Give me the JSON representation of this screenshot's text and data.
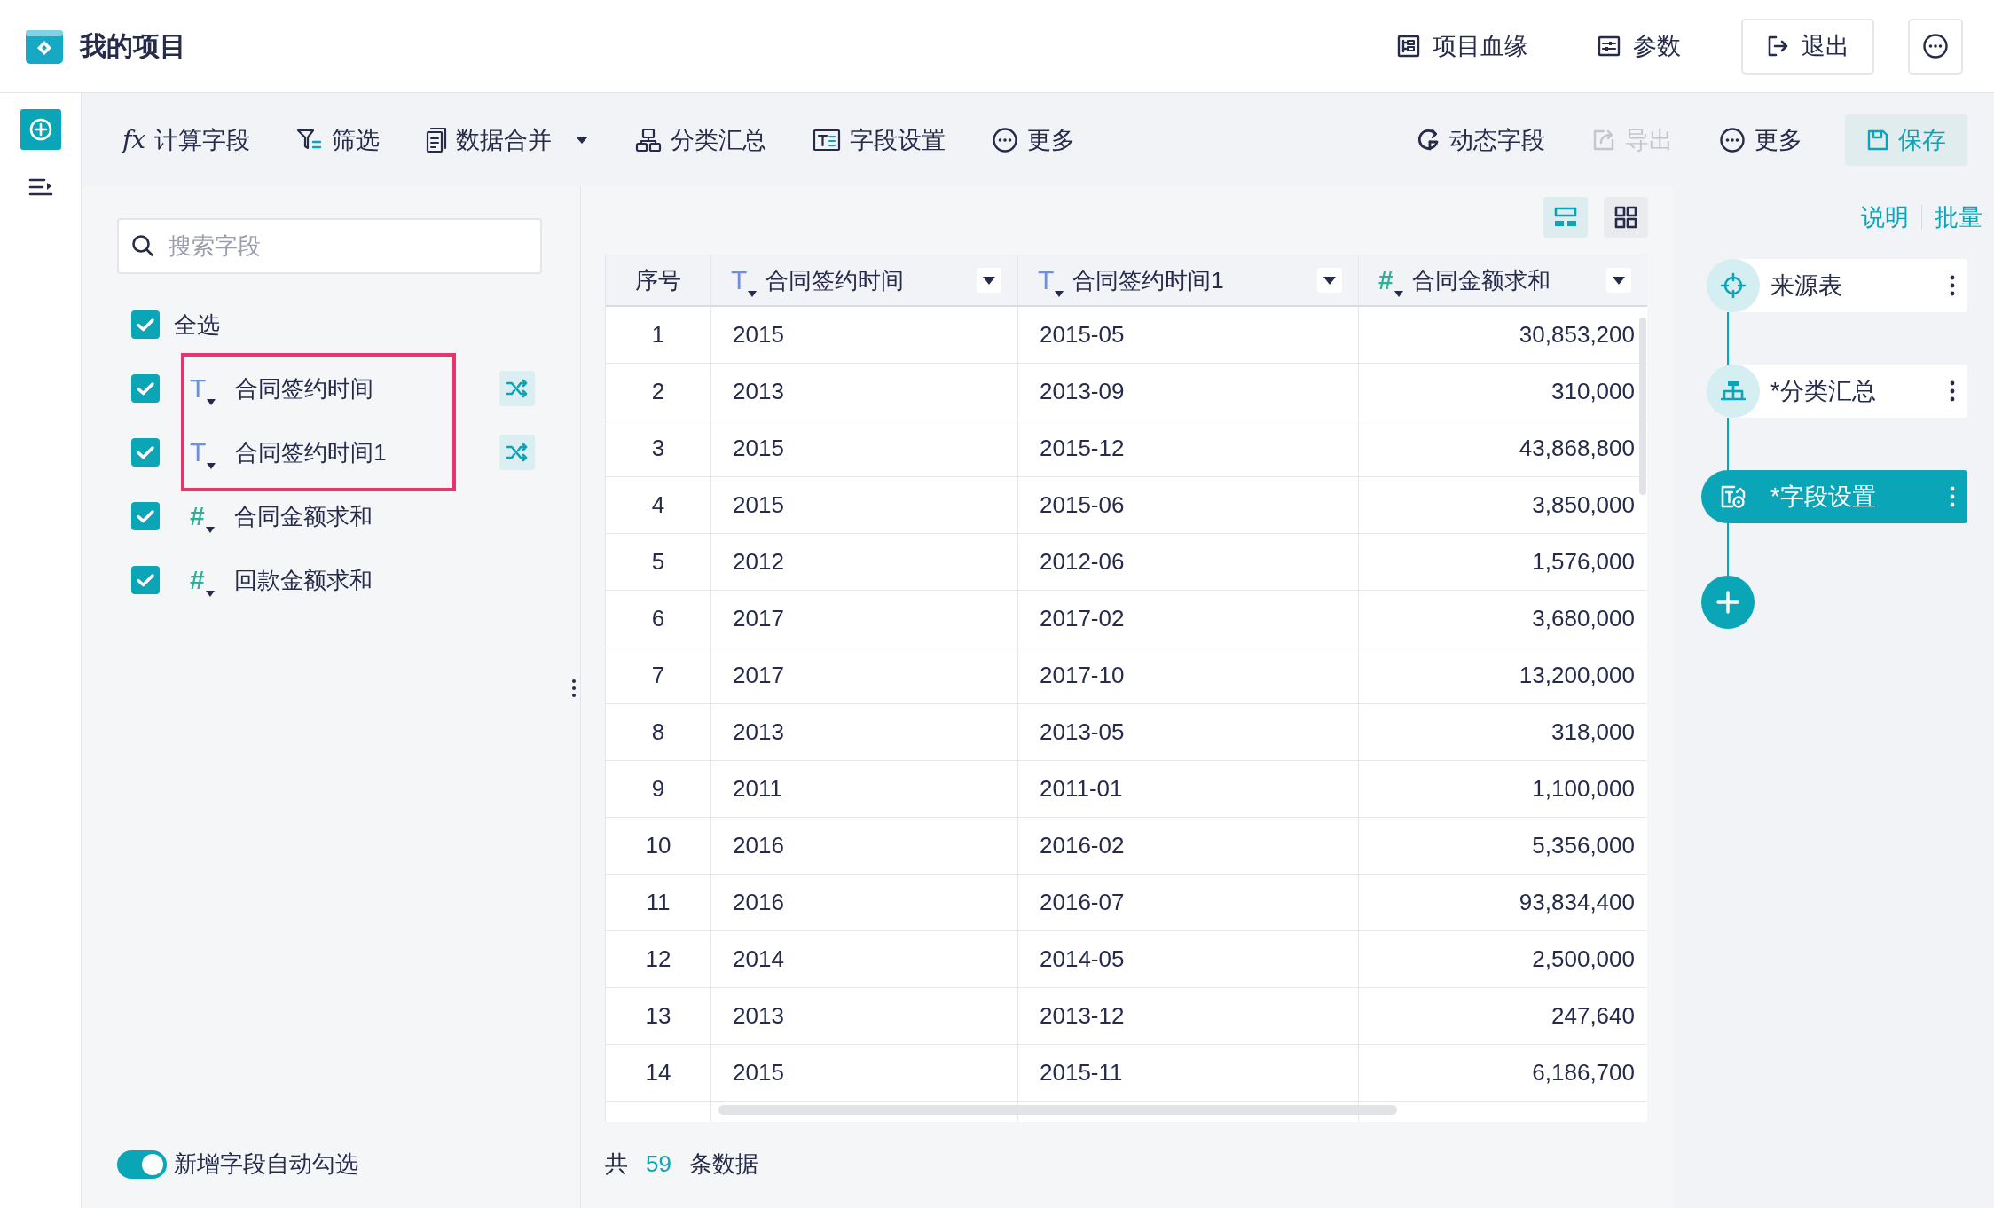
{
  "app": {
    "title": "我的项目"
  },
  "header_actions": [
    {
      "kind": "lineage",
      "label": "项目血缘"
    },
    {
      "kind": "params",
      "label": "参数"
    },
    {
      "kind": "exit",
      "label": "退出"
    },
    {
      "kind": "more"
    }
  ],
  "rail": [
    {
      "kind": "add"
    },
    {
      "kind": "list"
    }
  ],
  "toolbar": {
    "left": [
      {
        "kind": "formula",
        "symbol": "fx",
        "label": "计算字段"
      },
      {
        "kind": "filter",
        "label": "筛选"
      },
      {
        "kind": "merge",
        "label": "数据合并",
        "dropdown": true
      },
      {
        "kind": "group",
        "label": "分类汇总"
      },
      {
        "kind": "fields",
        "label": "字段设置"
      },
      {
        "kind": "more",
        "label": "更多"
      }
    ],
    "right": [
      {
        "kind": "dynamic",
        "label": "动态字段",
        "disabled": false
      },
      {
        "kind": "export",
        "label": "导出",
        "disabled": true
      },
      {
        "kind": "more",
        "label": "更多",
        "disabled": false
      },
      {
        "kind": "save",
        "label": "保存",
        "disabled": false
      }
    ]
  },
  "field_panel": {
    "search": {
      "placeholder": "搜索字段"
    },
    "select_all": {
      "label": "全选",
      "checked": true
    },
    "fields": [
      {
        "kind": "text",
        "symbol": "T",
        "label": "合同签约时间",
        "checked": true,
        "highlighted": true,
        "shuffle": true
      },
      {
        "kind": "text",
        "symbol": "T",
        "label": "合同签约时间1",
        "checked": true,
        "highlighted": true,
        "shuffle": true
      },
      {
        "kind": "number",
        "symbol": "#",
        "label": "合同金额求和",
        "checked": true,
        "highlighted": false,
        "shuffle": false
      },
      {
        "kind": "number",
        "symbol": "#",
        "label": "回款金额求和",
        "checked": true,
        "highlighted": false,
        "shuffle": false
      }
    ],
    "auto_select": {
      "label": "新增字段自动勾选",
      "on": true
    }
  },
  "view_modes": [
    {
      "kind": "table",
      "selected": true
    },
    {
      "kind": "grid",
      "selected": false
    }
  ],
  "table": {
    "columns": [
      {
        "kind": "index",
        "label": "序号"
      },
      {
        "kind": "text",
        "symbol": "T",
        "label": "合同签约时间"
      },
      {
        "kind": "text",
        "symbol": "T",
        "label": "合同签约时间1"
      },
      {
        "kind": "number",
        "symbol": "#",
        "label": "合同金额求和"
      }
    ],
    "rows": [
      [
        "1",
        "2015",
        "2015-05",
        "30,853,200"
      ],
      [
        "2",
        "2013",
        "2013-09",
        "310,000"
      ],
      [
        "3",
        "2015",
        "2015-12",
        "43,868,800"
      ],
      [
        "4",
        "2015",
        "2015-06",
        "3,850,000"
      ],
      [
        "5",
        "2012",
        "2012-06",
        "1,576,000"
      ],
      [
        "6",
        "2017",
        "2017-02",
        "3,680,000"
      ],
      [
        "7",
        "2017",
        "2017-10",
        "13,200,000"
      ],
      [
        "8",
        "2013",
        "2013-05",
        "318,000"
      ],
      [
        "9",
        "2011",
        "2011-01",
        "1,100,000"
      ],
      [
        "10",
        "2016",
        "2016-02",
        "5,356,000"
      ],
      [
        "11",
        "2016",
        "2016-07",
        "93,834,400"
      ],
      [
        "12",
        "2014",
        "2014-05",
        "2,500,000"
      ],
      [
        "13",
        "2013",
        "2013-12",
        "247,640"
      ],
      [
        "14",
        "2015",
        "2015-11",
        "6,186,700"
      ]
    ]
  },
  "footer": {
    "prefix": "共",
    "count": "59",
    "suffix": "条数据"
  },
  "flow": {
    "links": [
      "说明",
      "批量"
    ],
    "nodes": [
      {
        "kind": "source",
        "label": "来源表",
        "selected": false
      },
      {
        "kind": "group",
        "label": "*分类汇总",
        "selected": false
      },
      {
        "kind": "fields",
        "label": "*字段设置",
        "selected": true
      }
    ]
  }
}
